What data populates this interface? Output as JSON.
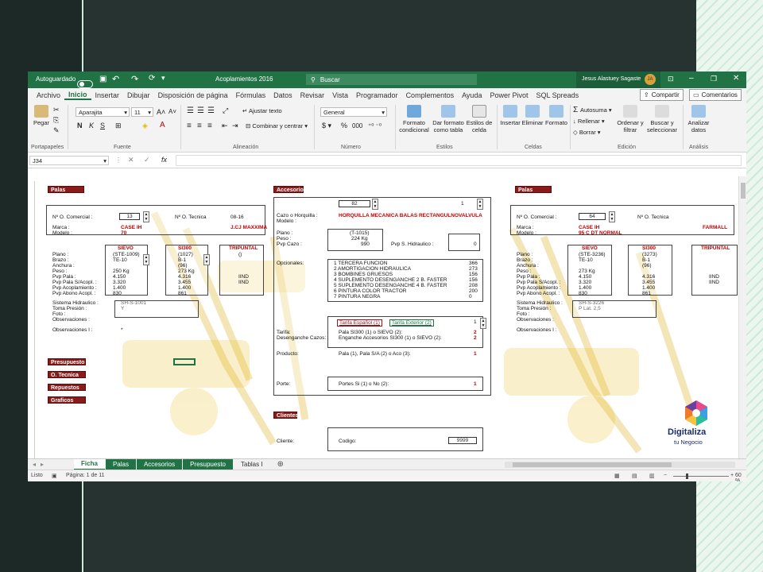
{
  "titlebar": {
    "autosave_label": "Autoguardado",
    "file_name": "Acoplamientos 2016",
    "search_placeholder": "Buscar",
    "user_name": "Jesus Alastuey Sagaste",
    "user_initials": "JA"
  },
  "menu": {
    "tabs": [
      "Archivo",
      "Inicio",
      "Insertar",
      "Dibujar",
      "Disposición de página",
      "Fórmulas",
      "Datos",
      "Revisar",
      "Vista",
      "Programador",
      "Complementos",
      "Ayuda",
      "Power Pivot",
      "SQL Spreads"
    ],
    "share_label": "Compartir",
    "comments_label": "Comentarios"
  },
  "ribbon": {
    "paste_label": "Pegar",
    "clipboard_label": "Portapapeles",
    "font_name": "Aparajita",
    "font_size": "11",
    "font_label": "Fuente",
    "bold": "N",
    "italic": "K",
    "underline": "S",
    "wrap_text": "Ajustar texto",
    "merge_center": "Combinar y centrar",
    "alignment_label": "Alineación",
    "number_format": "General",
    "percent": "%",
    "thousands": "000",
    "number_label": "Número",
    "cond_format_1": "Formato",
    "cond_format_2": "condicional",
    "format_table_1": "Dar formato",
    "format_table_2": "como tabla",
    "cell_styles_1": "Estilos de",
    "cell_styles_2": "celda",
    "styles_label": "Estilos",
    "insert": "Insertar",
    "delete": "Eliminar",
    "format": "Formato",
    "cells_label": "Celdas",
    "autosum": "Autosuma",
    "fill": "Rellenar",
    "clear": "Borrar",
    "sort_1": "Ordenar y",
    "sort_2": "filtrar",
    "find_1": "Buscar y",
    "find_2": "seleccionar",
    "editing_label": "Edición",
    "analyze_1": "Analizar",
    "analyze_2": "datos",
    "analysis_label": "Análisis"
  },
  "formula_bar": {
    "name_box": "J34",
    "fx": "fx"
  },
  "sheet": {
    "left": {
      "header": "Palas",
      "comercial_label": "Nº O. Comercial :",
      "comercial_value": "13",
      "tecnica_label": "Nº O. Tecnica",
      "tecnica_value": "08-16",
      "marca_label": "Marca :",
      "marca_value": "CASE IH",
      "marca_value_2": "J.CJ MAXXIMA",
      "modelo_label": "Modelo :",
      "modelo_value": "70",
      "col1": "SIEVO",
      "col2": "SI300",
      "col3": "TRIPUNTAL",
      "rows": [
        "Plano :",
        "Brazo :",
        "Anchura :",
        "Peso :",
        "Pvp Pala :",
        "Pvp Pala S/Acopl. :",
        "Pvp Acoplamiento :",
        "Pvp Abono Acopl. :"
      ],
      "v1": [
        "(STE-1009)",
        "TE-10",
        "",
        "250 Kg",
        "4.150",
        "3.320",
        "1.400",
        "830"
      ],
      "v2": [
        "(1027)",
        "B-1",
        "(96)",
        "273 Kg",
        "4.316",
        "3.455",
        "1.400",
        "861"
      ],
      "v3": [
        "()",
        "",
        "",
        "",
        "IIND",
        "IIND",
        "",
        ""
      ],
      "sistema_label": "Sistema Hidraulico :",
      "sistema_value": "SH-S-1001",
      "toma_label": "Toma Presión :",
      "toma_value": "Y",
      "foto_label": "Foto :",
      "obs_label": "Observaciones :",
      "obs1_label": "Observaciones I :",
      "obs1_value": "*",
      "buttons": [
        "Presupuesto",
        "O. Tecnica",
        "Repuestos",
        "Graficos"
      ]
    },
    "center": {
      "header": "Accesorios",
      "num": "82",
      "num2": "1",
      "cazo_label": "Cazo o Horquilla :",
      "cazo_value": "HORQUILLA MECANICA BALAS RECTANGULNOVALVULA",
      "modelo_label": "Modelo :",
      "plano_label": "Plano :",
      "plano_value": "(T-1015)",
      "peso_label": "Peso :",
      "peso_value": "224 Kg",
      "pvp_cazo_label": "Pvp Cazo :",
      "pvp_cazo_value": "990",
      "pvp_hidr_label": "Pvp S. Hidraulico :",
      "pvp_hidr_value": "0",
      "opcionales_label": "Opcionales:",
      "opcionales": [
        "1  TERCERA FUNCION",
        "2  AMORTIGACION HIDRAULICA",
        "3  BOMBINES GRUESOS",
        "4  SUPLEMENTO DESENGANCHE 2 B. FASTER",
        "5  SUPLEMENTO DESENGANCHE 4 B. FASTER",
        "6  PINTURA COLOR TRACTOR",
        "7  PINTURA NEGRA"
      ],
      "opcionales_precio": [
        "366",
        "273",
        "156",
        "156",
        "208",
        "200",
        "0"
      ],
      "tarifa_es": "Tarifa Español (1)",
      "tarifa_ex": "Tarifa Exterior (2)",
      "tarifa_num": "1",
      "tarifa_label": "Tarifa:",
      "desen_label": "Desenganche Cazos:",
      "pala_si": "Pala SI300 (1) o SIEVO (2):",
      "pala_si_val": "2",
      "engan": "Enganche Accesorios SI300 (1) o SIEVO (2):",
      "engan_val": "2",
      "producto_label": "Producto:",
      "producto": "Pala (1), Pala S/A (2) o Aco (3):",
      "producto_val": "1",
      "porte_label": "Porte:",
      "porte": "Portes Si (1) o No (2):",
      "porte_val": "1",
      "clientes_header": "Clientes",
      "cliente_label": "Cliente:",
      "codigo_label": "Codigo:",
      "codigo_value": "9999"
    },
    "right": {
      "header": "Palas",
      "comercial_label": "Nº O. Comercial :",
      "comercial_value": "64",
      "tecnica_label": "Nº O. Tecnica",
      "marca_label": "Marca :",
      "marca_value": "CASE IH",
      "marca_value_2": "FARMALL",
      "modelo_label": "Modelo :",
      "modelo_value": "95 C DT NORMAL",
      "col1": "SIEVO",
      "col2": "SI300",
      "col3": "TRIPUNTAL",
      "rows": [
        "Plano :",
        "Brazo :",
        "Anchura :",
        "Peso :",
        "Pvp Pala :",
        "Pvp Pala S/Acopl. :",
        "Pvp Acoplamiento :",
        "Pvp Abono Acopl. :"
      ],
      "v1": [
        "(STE-3236)",
        "TE-10",
        "",
        "273 Kg",
        "4.150",
        "3.320",
        "1.400",
        "830"
      ],
      "v2": [
        "(3273)",
        "B-1",
        "(96)",
        "",
        "4.316",
        "3.455",
        "1.400",
        "861"
      ],
      "v3": [
        "",
        "",
        "",
        "",
        "IIND",
        "IIND",
        "",
        ""
      ],
      "sistema_label": "Sistema Hidraulico :",
      "sistema_value": "SH-S-3226",
      "toma_label": "Toma Presión :",
      "toma_value": "P Lat. 2,5",
      "foto_label": "Foto :",
      "obs_label": "Observaciones :",
      "obs1_label": "Observaciones I :"
    }
  },
  "sheet_tabs": [
    "Ficha",
    "Palas",
    "Accesorios",
    "Presupuesto",
    "Tablas I"
  ],
  "status": {
    "ready": "Listo",
    "page": "Página: 1 de 11",
    "zoom": "60 %"
  },
  "brand": {
    "line1": "Digitaliza",
    "line2": "tu Negocio"
  },
  "colors": {
    "excel_green": "#217346",
    "header_red": "#8b1a1a",
    "value_red": "#c00000"
  }
}
